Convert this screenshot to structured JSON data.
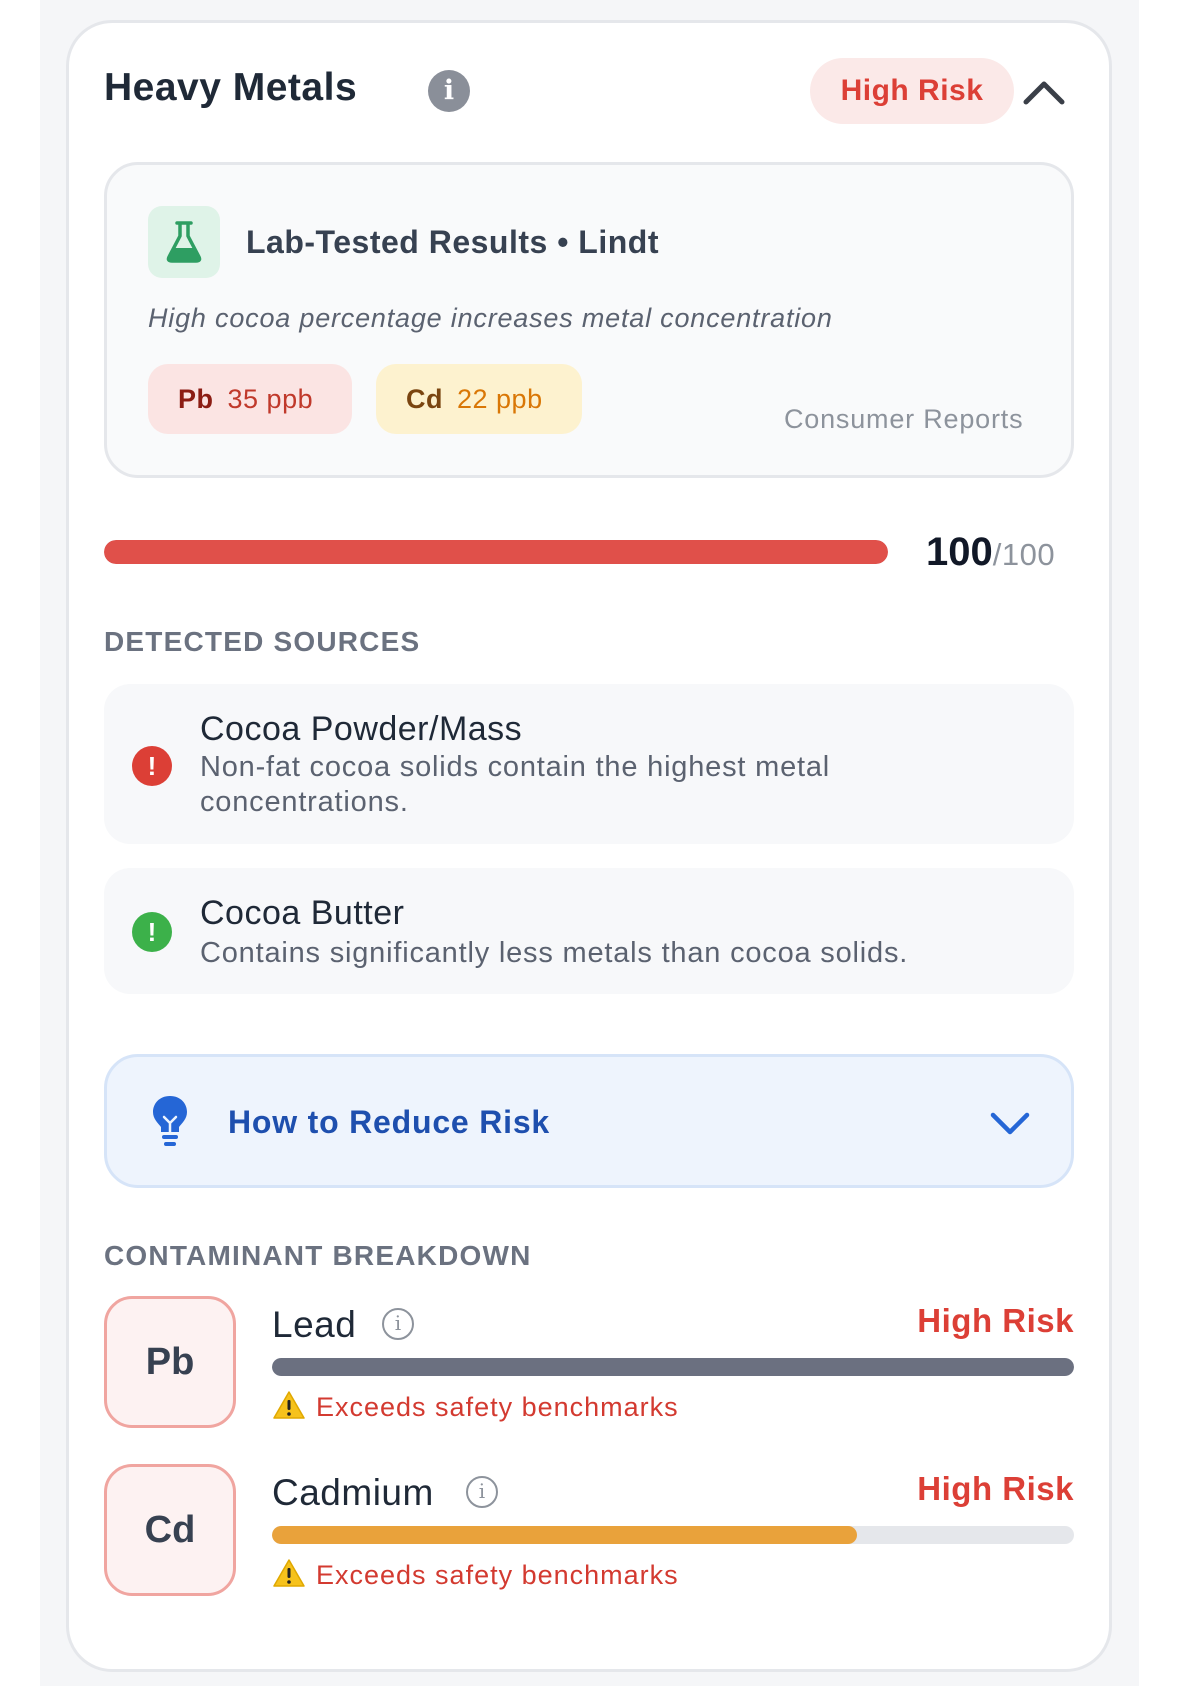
{
  "header": {
    "title": "Heavy Metals",
    "risk_label": "High Risk",
    "info_icon": "info-icon",
    "collapse_icon": "chevron-up-icon"
  },
  "lab": {
    "icon": "flask-icon",
    "title": "Lab-Tested Results • Lindt",
    "note": "High cocoa percentage increases metal concentration",
    "chips": [
      {
        "symbol": "Pb",
        "value": "35 ppb"
      },
      {
        "symbol": "Cd",
        "value": "22 ppb"
      }
    ],
    "credit": "Consumer Reports"
  },
  "score": {
    "value": "100",
    "max": "/100",
    "fraction": 1.0
  },
  "sources": {
    "label": "DETECTED SOURCES",
    "items": [
      {
        "name": "Cocoa Powder/Mass",
        "desc": "Non-fat cocoa solids contain the highest metal concentrations.",
        "status": "bad"
      },
      {
        "name": "Cocoa Butter",
        "desc": "Contains significantly less metals than cocoa solids.",
        "status": "good"
      }
    ]
  },
  "reduce": {
    "label": "How to Reduce Risk",
    "icon": "lightbulb-icon"
  },
  "breakdown": {
    "label": "CONTAMINANT BREAKDOWN",
    "items": [
      {
        "symbol": "Pb",
        "name": "Lead",
        "risk": "High Risk",
        "warning": "Exceeds safety benchmarks",
        "level": 1.0,
        "bar_color": "#6b7080"
      },
      {
        "symbol": "Cd",
        "name": "Cadmium",
        "risk": "High Risk",
        "warning": "Exceeds safety benchmarks",
        "level": 0.73,
        "bar_color": "#e9a23b"
      }
    ]
  },
  "colors": {
    "danger": "#dc3f36",
    "safe": "#3cb14a",
    "accent_blue": "#1e4fae"
  }
}
